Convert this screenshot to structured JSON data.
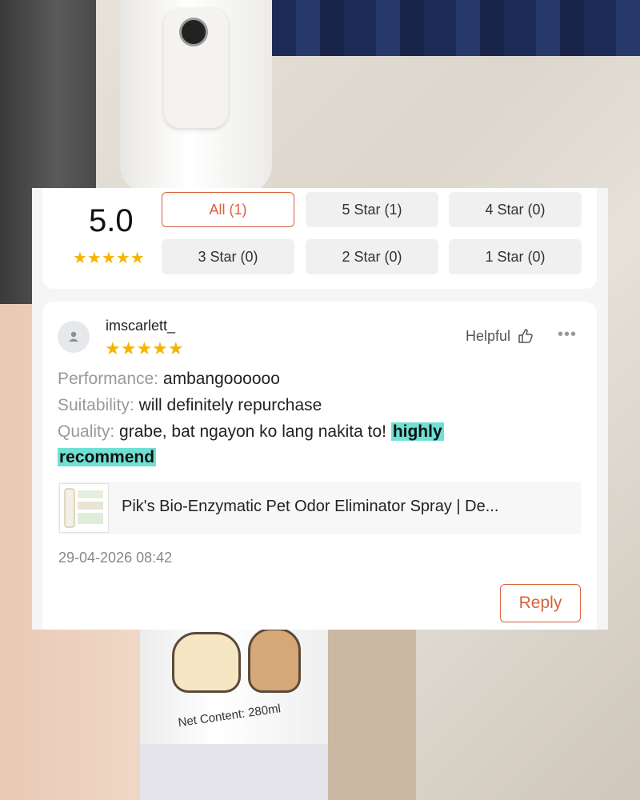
{
  "rating_summary": {
    "score": "5.0",
    "stars": "★★★★★",
    "filters": [
      {
        "label": "All (1)",
        "active": true
      },
      {
        "label": "5 Star (1)",
        "active": false
      },
      {
        "label": "4 Star (0)",
        "active": false
      },
      {
        "label": "3 Star (0)",
        "active": false
      },
      {
        "label": "2 Star (0)",
        "active": false
      },
      {
        "label": "1 Star (0)",
        "active": false
      }
    ]
  },
  "review": {
    "username": "imscarlett_",
    "stars": "★★★★★",
    "helpful_label": "Helpful",
    "more_label": "•••",
    "performance_key": "Performance:",
    "performance_value": "ambangoooooo",
    "suitability_key": "Suitability:",
    "suitability_value": "will definitely repurchase",
    "quality_key": "Quality:",
    "quality_value": "grabe, bat ngayon ko lang nakita to!",
    "quality_highlight_1": "highly",
    "quality_highlight_2": "recommend",
    "product_name": "Pik's Bio-Enzymatic Pet Odor Eliminator Spray | De...",
    "timestamp": "29-04-2026 08:42",
    "reply_label": "Reply"
  },
  "photo": {
    "bottle_label": "Net Content: 280ml"
  },
  "colors": {
    "accent": "#d9603b",
    "star": "#f5b400",
    "highlight": "#6fe0d3"
  }
}
